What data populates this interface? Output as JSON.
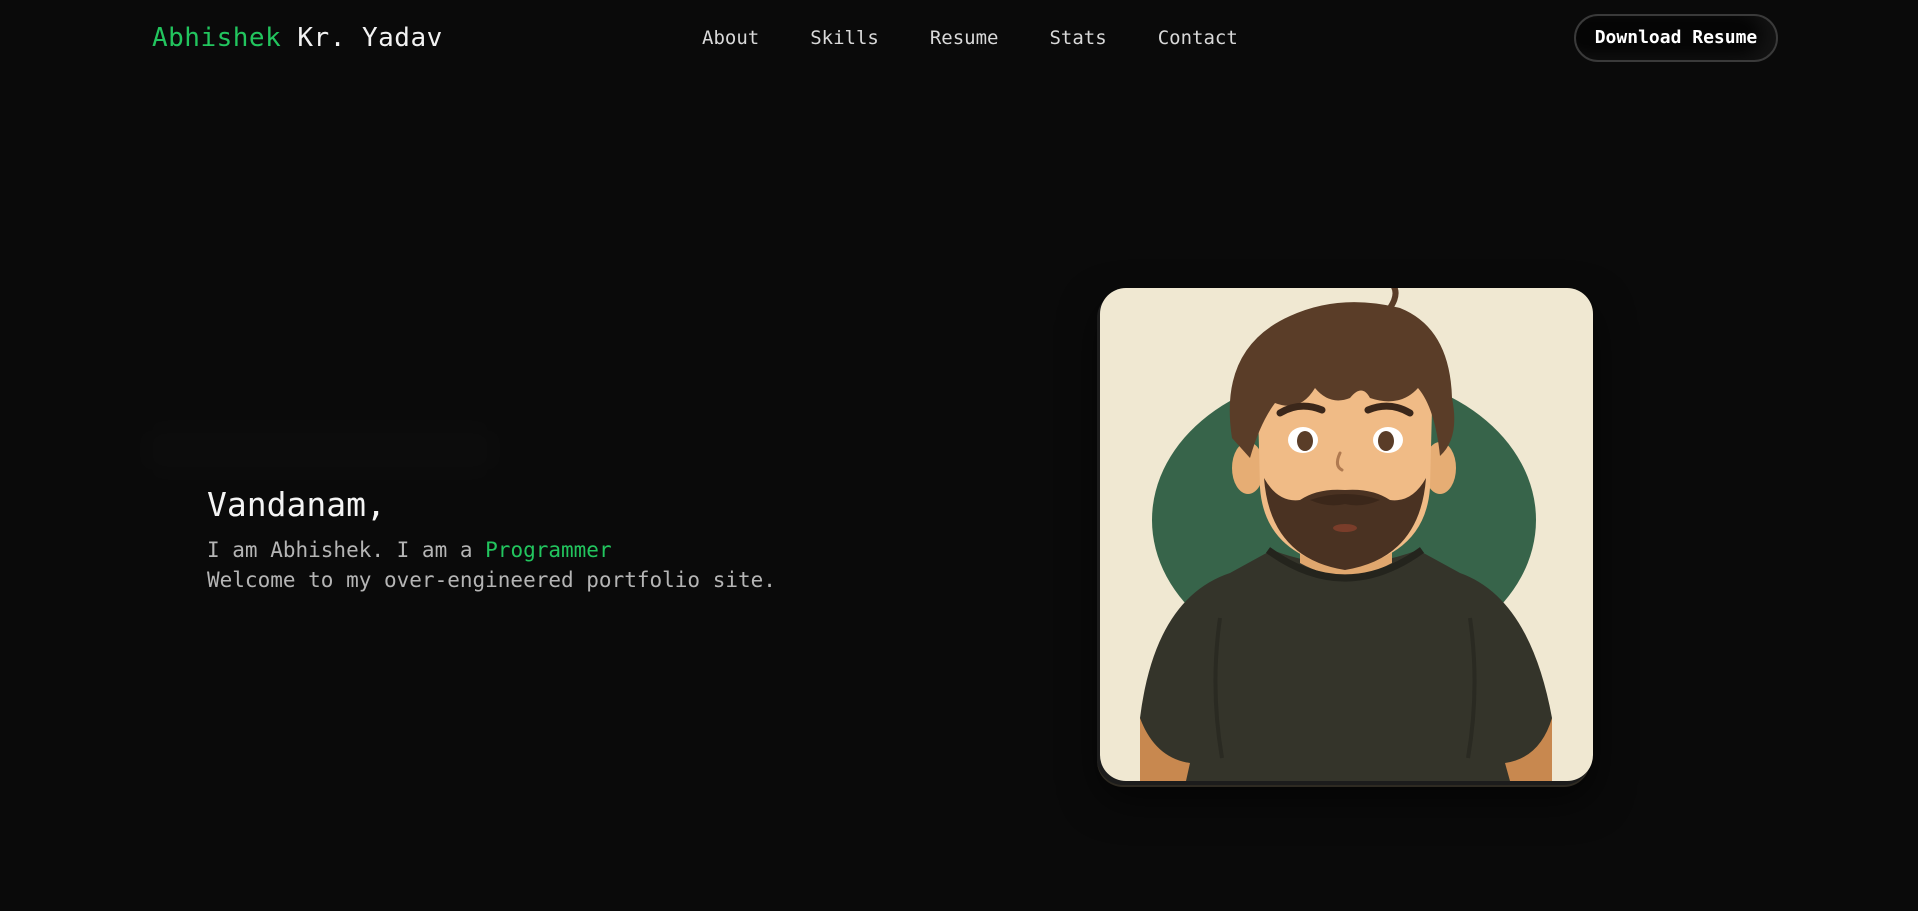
{
  "brand": {
    "first_name": "Abhishek",
    "last_name": "Kr. Yadav"
  },
  "nav": {
    "items": [
      {
        "label": "About"
      },
      {
        "label": "Skills"
      },
      {
        "label": "Resume"
      },
      {
        "label": "Stats"
      },
      {
        "label": "Contact"
      }
    ],
    "download_label": "Download Resume"
  },
  "hero": {
    "greeting": "Vandanam,",
    "intro_prefix": "I am Abhishek. I am a ",
    "role": "Programmer",
    "tagline": "Welcome to my over-engineered portfolio site."
  },
  "avatar": {
    "icon": "cartoon-portrait"
  },
  "colors": {
    "background": "#0a0a0a",
    "accent": "#22c55e",
    "card_bg": "#f0e8d2",
    "circle": "#37644a",
    "shirt": "#34342a"
  }
}
